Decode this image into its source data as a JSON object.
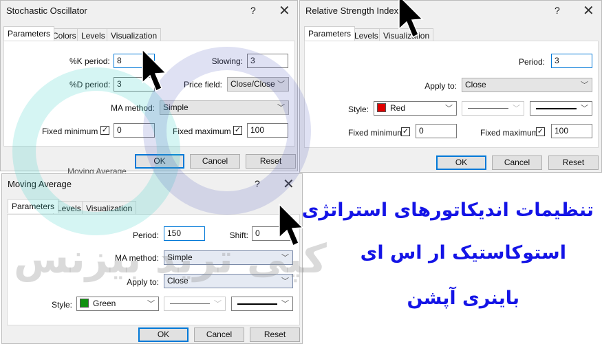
{
  "stochastic": {
    "title": "Stochastic Oscillator",
    "help": "?",
    "close": "✕",
    "tabs": [
      "Parameters",
      "Colors",
      "Levels",
      "Visualization"
    ],
    "k_label": "%K period:",
    "k_value": "8",
    "slowing_label": "Slowing:",
    "slowing_value": "3",
    "d_label": "%D period:",
    "d_value": "3",
    "price_label": "Price field:",
    "price_value": "Close/Close",
    "ma_label": "MA method:",
    "ma_value": "Simple",
    "min_label": "Fixed minimum",
    "min_value": "0",
    "min_checked": true,
    "max_label": "Fixed maximum",
    "max_value": "100",
    "max_checked": true,
    "ok": "OK",
    "cancel": "Cancel",
    "reset": "Reset"
  },
  "rsi": {
    "title": "Relative Strength Index",
    "help": "?",
    "close": "✕",
    "tabs": [
      "Parameters",
      "Levels",
      "Visualization"
    ],
    "period_label": "Period:",
    "period_value": "3",
    "apply_label": "Apply to:",
    "apply_value": "Close",
    "style_label": "Style:",
    "color_value": "Red",
    "color_hex": "#e00000",
    "min_label": "Fixed minimum",
    "min_value": "0",
    "min_checked": true,
    "max_label": "Fixed maximum",
    "max_value": "100",
    "max_checked": true,
    "ok": "OK",
    "cancel": "Cancel",
    "reset": "Reset"
  },
  "ma": {
    "title": "Moving Average",
    "help": "?",
    "close": "✕",
    "tabs": [
      "Parameters",
      "Levels",
      "Visualization"
    ],
    "period_label": "Period:",
    "period_value": "150",
    "shift_label": "Shift:",
    "shift_value": "0",
    "method_label": "MA method:",
    "method_value": "Simple",
    "apply_label": "Apply to:",
    "apply_value": "Close",
    "style_label": "Style:",
    "color_value": "Green",
    "color_hex": "#109010",
    "ok": "OK",
    "cancel": "Cancel",
    "reset": "Reset",
    "behind_label": "Moving Average"
  },
  "caption": {
    "line1": "تنظیمات اندیکاتورهای استراتژی",
    "line2": "استوکاستیک ار اس ای",
    "line3": "باینری آپشن",
    "color": "#1414e6"
  },
  "watermark": {
    "text": "کپی ترید بیزنس"
  }
}
